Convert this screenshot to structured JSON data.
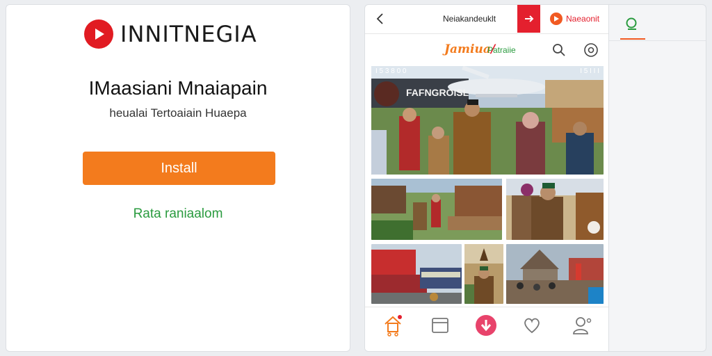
{
  "install_page": {
    "brand_name": "INNITNEGIA",
    "title": "IMaasiani Mnaiapain",
    "subtitle": "heualai Tertoaiain Huaepa",
    "install_label": "Install",
    "secondary_link": "Rata raniaalom"
  },
  "phone": {
    "header": {
      "title": "Neiakandeuklt",
      "brand_label": "Naeaonit"
    },
    "subheader": {
      "logo_text": "Jamiua",
      "tagline": "Patraiie"
    },
    "hero": {
      "label_left": "I 5 3 8 0 0",
      "label_right": "I 5 I I I",
      "sign_text": "FAFNGROISL"
    },
    "nav": [
      "home",
      "window",
      "download",
      "favorites",
      "profile"
    ],
    "accent": "#f37b1d",
    "brand_red": "#e4202e",
    "link_green": "#2a9b3f"
  }
}
